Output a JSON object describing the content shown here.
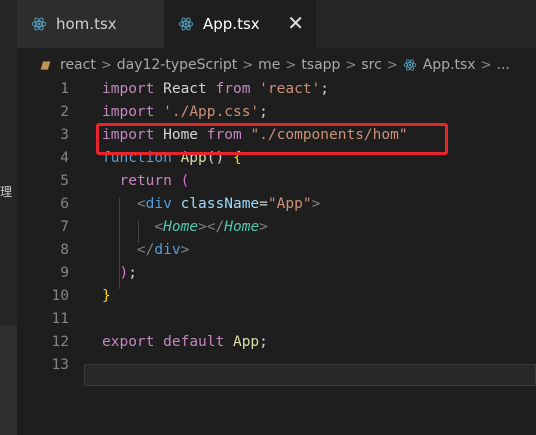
{
  "side": {
    "glyph": "理"
  },
  "tabs": [
    {
      "label": "hom.tsx",
      "icon": "react-icon",
      "active": false
    },
    {
      "label": "App.tsx",
      "icon": "react-icon",
      "active": true
    }
  ],
  "breadcrumb": {
    "items": [
      "react",
      "day12-typeScript",
      "me",
      "tsapp",
      "src"
    ],
    "file": "App.tsx",
    "more": "..."
  },
  "editor": {
    "line_numbers": [
      "1",
      "2",
      "3",
      "4",
      "5",
      "6",
      "7",
      "8",
      "9",
      "10",
      "11",
      "12",
      "13"
    ],
    "lines": [
      [
        [
          "kw",
          "import"
        ],
        [
          "id",
          " React "
        ],
        [
          "kw",
          "from"
        ],
        [
          "id",
          " "
        ],
        [
          "str",
          "'react'"
        ],
        [
          "id",
          ";"
        ]
      ],
      [
        [
          "kw",
          "import"
        ],
        [
          "id",
          " "
        ],
        [
          "str",
          "'./App.css'"
        ],
        [
          "id",
          ";"
        ]
      ],
      [
        [
          "kw",
          "import"
        ],
        [
          "id",
          " Home "
        ],
        [
          "kw",
          "from"
        ],
        [
          "id",
          " "
        ],
        [
          "str",
          "\"./components/hom\""
        ]
      ],
      [
        [
          "fn-kw",
          "function"
        ],
        [
          "id",
          " "
        ],
        [
          "fn",
          "App"
        ],
        [
          "id",
          "() "
        ],
        [
          "brace",
          "{"
        ]
      ],
      [
        [
          "id",
          "  "
        ],
        [
          "kw",
          "return"
        ],
        [
          "id",
          " "
        ],
        [
          "paren2",
          "("
        ]
      ],
      [
        [
          "id",
          "    "
        ],
        [
          "punct-tag",
          "<"
        ],
        [
          "tag",
          "div"
        ],
        [
          "id",
          " "
        ],
        [
          "attr",
          "className"
        ],
        [
          "id",
          "="
        ],
        [
          "str",
          "\"App\""
        ],
        [
          "punct-tag",
          ">"
        ]
      ],
      [
        [
          "id",
          "      "
        ],
        [
          "punct-tag",
          "<"
        ],
        [
          "comp",
          "Home"
        ],
        [
          "punct-tag",
          "></"
        ],
        [
          "comp",
          "Home"
        ],
        [
          "punct-tag",
          ">"
        ]
      ],
      [
        [
          "id",
          "    "
        ],
        [
          "punct-tag",
          "</"
        ],
        [
          "tag",
          "div"
        ],
        [
          "punct-tag",
          ">"
        ]
      ],
      [
        [
          "id",
          "  "
        ],
        [
          "paren2",
          ")"
        ],
        [
          "id",
          ";"
        ]
      ],
      [
        [
          "brace",
          "}"
        ]
      ],
      [],
      [
        [
          "kw",
          "export"
        ],
        [
          "id",
          " "
        ],
        [
          "kw",
          "default"
        ],
        [
          "id",
          " "
        ],
        [
          "fn",
          "App"
        ],
        [
          "id",
          ";"
        ]
      ],
      []
    ]
  },
  "colors": {
    "background": "#1e1e1e",
    "highlight_box": "#e8242c",
    "keyword": "#c586c0",
    "string": "#ce9178"
  }
}
